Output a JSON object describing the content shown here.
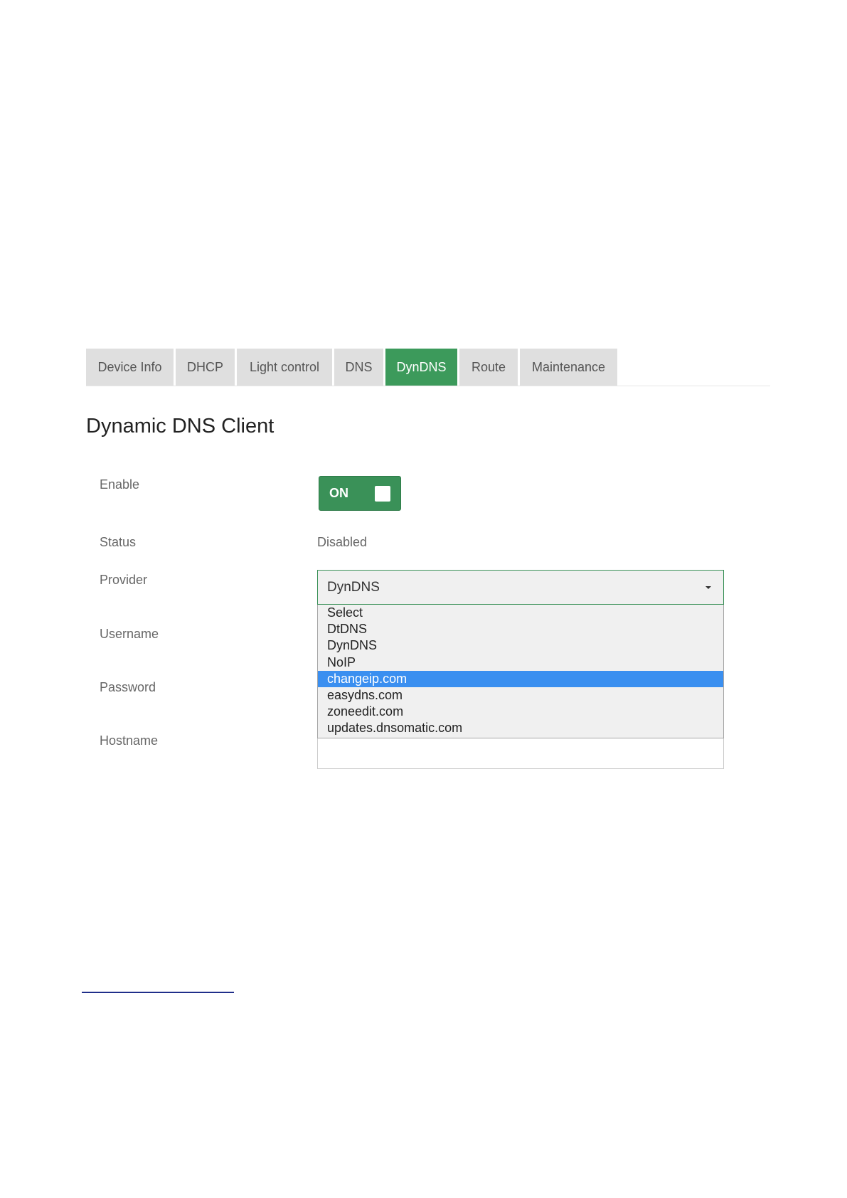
{
  "tabs": [
    {
      "label": "Device Info",
      "active": false
    },
    {
      "label": "DHCP",
      "active": false
    },
    {
      "label": "Light control",
      "active": false
    },
    {
      "label": "DNS",
      "active": false
    },
    {
      "label": "DynDNS",
      "active": true
    },
    {
      "label": "Route",
      "active": false
    },
    {
      "label": "Maintenance",
      "active": false
    }
  ],
  "page_title": "Dynamic DNS Client",
  "form": {
    "enable_label": "Enable",
    "enable_toggle_text": "ON",
    "status_label": "Status",
    "status_value": "Disabled",
    "provider_label": "Provider",
    "provider_selected": "DynDNS",
    "username_label": "Username",
    "password_label": "Password",
    "hostname_label": "Hostname",
    "hostname_value": ""
  },
  "provider_options": [
    "Select",
    "DtDNS",
    "DynDNS",
    "NoIP",
    "changeip.com",
    "easydns.com",
    "zoneedit.com",
    "updates.dnsomatic.com"
  ],
  "highlighted_option": "changeip.com",
  "colors": {
    "accent_green": "#3c9a5b",
    "toggle_green": "#3a9158",
    "highlight_blue": "#3a8ff0",
    "tab_inactive": "#dfdfdf",
    "footnote_rule": "#1f2e8a"
  }
}
